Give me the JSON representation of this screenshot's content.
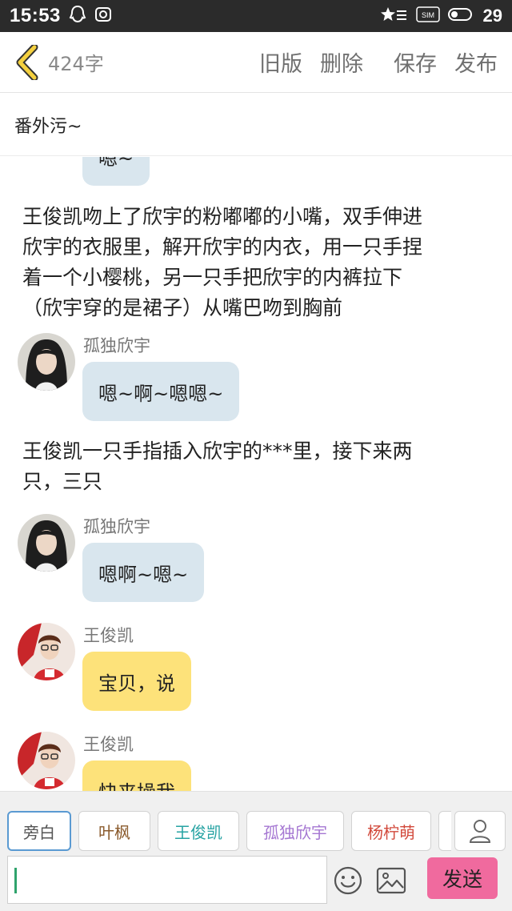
{
  "status_bar": {
    "time": "15:53",
    "sim_label": "SIM",
    "battery": "29"
  },
  "header": {
    "word_count": "424字",
    "actions": [
      "旧版",
      "删除",
      "保存",
      "发布"
    ]
  },
  "story": {
    "title": "番外污~"
  },
  "content": {
    "items": [
      {
        "type": "bubble_partial",
        "color": "blue",
        "text": "嗯~"
      },
      {
        "type": "narration",
        "lines": [
          "王俊凯吻上了欣宇的粉嘟嘟的小嘴，双手伸进",
          "欣宇的衣服里，解开欣宇的内衣，用一只手捏",
          "着一个小樱桃，另一只手把欣宇的内裤拉下",
          "（欣宇穿的是裙子）从嘴巴吻到胸前"
        ]
      },
      {
        "type": "message",
        "speaker": "孤独欣宇",
        "color": "blue",
        "text": "嗯~啊~嗯嗯~"
      },
      {
        "type": "narration",
        "lines": [
          "王俊凯一只手指插入欣宇的***里，接下来两",
          "只，三只"
        ]
      },
      {
        "type": "message",
        "speaker": "孤独欣宇",
        "color": "blue",
        "text": "嗯啊~嗯~"
      },
      {
        "type": "message",
        "speaker": "王俊凯",
        "color": "yellow",
        "text": "宝贝，说"
      },
      {
        "type": "message",
        "speaker": "王俊凯",
        "color": "yellow",
        "text": "快来操我"
      }
    ]
  },
  "bottom_bar": {
    "characters": [
      {
        "label": "旁白",
        "color": "#555555",
        "active": true
      },
      {
        "label": "叶枫",
        "color": "#8a5a2c",
        "active": false
      },
      {
        "label": "王俊凯",
        "color": "#27a3a3",
        "active": false
      },
      {
        "label": "孤独欣宇",
        "color": "#a577d2",
        "active": false
      },
      {
        "label": "杨柠萌",
        "color": "#d24a3c",
        "active": false
      }
    ],
    "input_value": "",
    "send_label": "发送"
  },
  "colors": {
    "accent_yellow": "#f1c40f",
    "bubble_blue": "#d9e6ee",
    "bubble_yellow": "#fde27a",
    "send_pink": "#f06a9e"
  }
}
